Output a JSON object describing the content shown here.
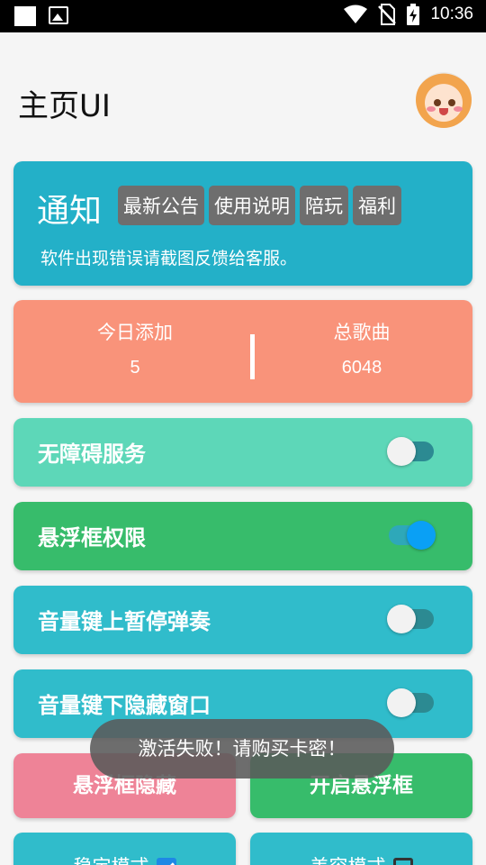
{
  "status_bar": {
    "time": "10:36",
    "icons": [
      "square-notification-icon",
      "image-notification-icon",
      "wifi-icon",
      "no-sim-icon",
      "battery-charging-icon"
    ]
  },
  "header": {
    "title": "主页UI",
    "avatar": "avatar-anime-girl"
  },
  "notice": {
    "title": "通知",
    "chips": [
      "最新公告",
      "使用说明",
      "陪玩",
      "福利"
    ],
    "message": "软件出现错误请截图反馈给客服。",
    "color": "#23b0c8"
  },
  "stats": {
    "today_label": "今日添加",
    "today_value": "5",
    "total_label": "总歌曲",
    "total_value": "6048",
    "color": "#f9937a"
  },
  "settings": [
    {
      "label": "无障碍服务",
      "enabled": false,
      "color": "#5dd7b8"
    },
    {
      "label": "悬浮框权限",
      "enabled": true,
      "color": "#37bc6b"
    },
    {
      "label": "音量键上暂停弹奏",
      "enabled": false,
      "color": "#30bccb"
    },
    {
      "label": "音量键下隐藏窗口",
      "enabled": false,
      "color": "#30bccb"
    }
  ],
  "buttons": {
    "hide_float": "悬浮框隐藏",
    "open_float": "开启悬浮框"
  },
  "modes": {
    "stable_label": "稳定模式",
    "stable_checked": true,
    "beauty_label": "美容模式",
    "beauty_checked": false
  },
  "toast": {
    "message": "激活失败！请购买卡密！"
  }
}
